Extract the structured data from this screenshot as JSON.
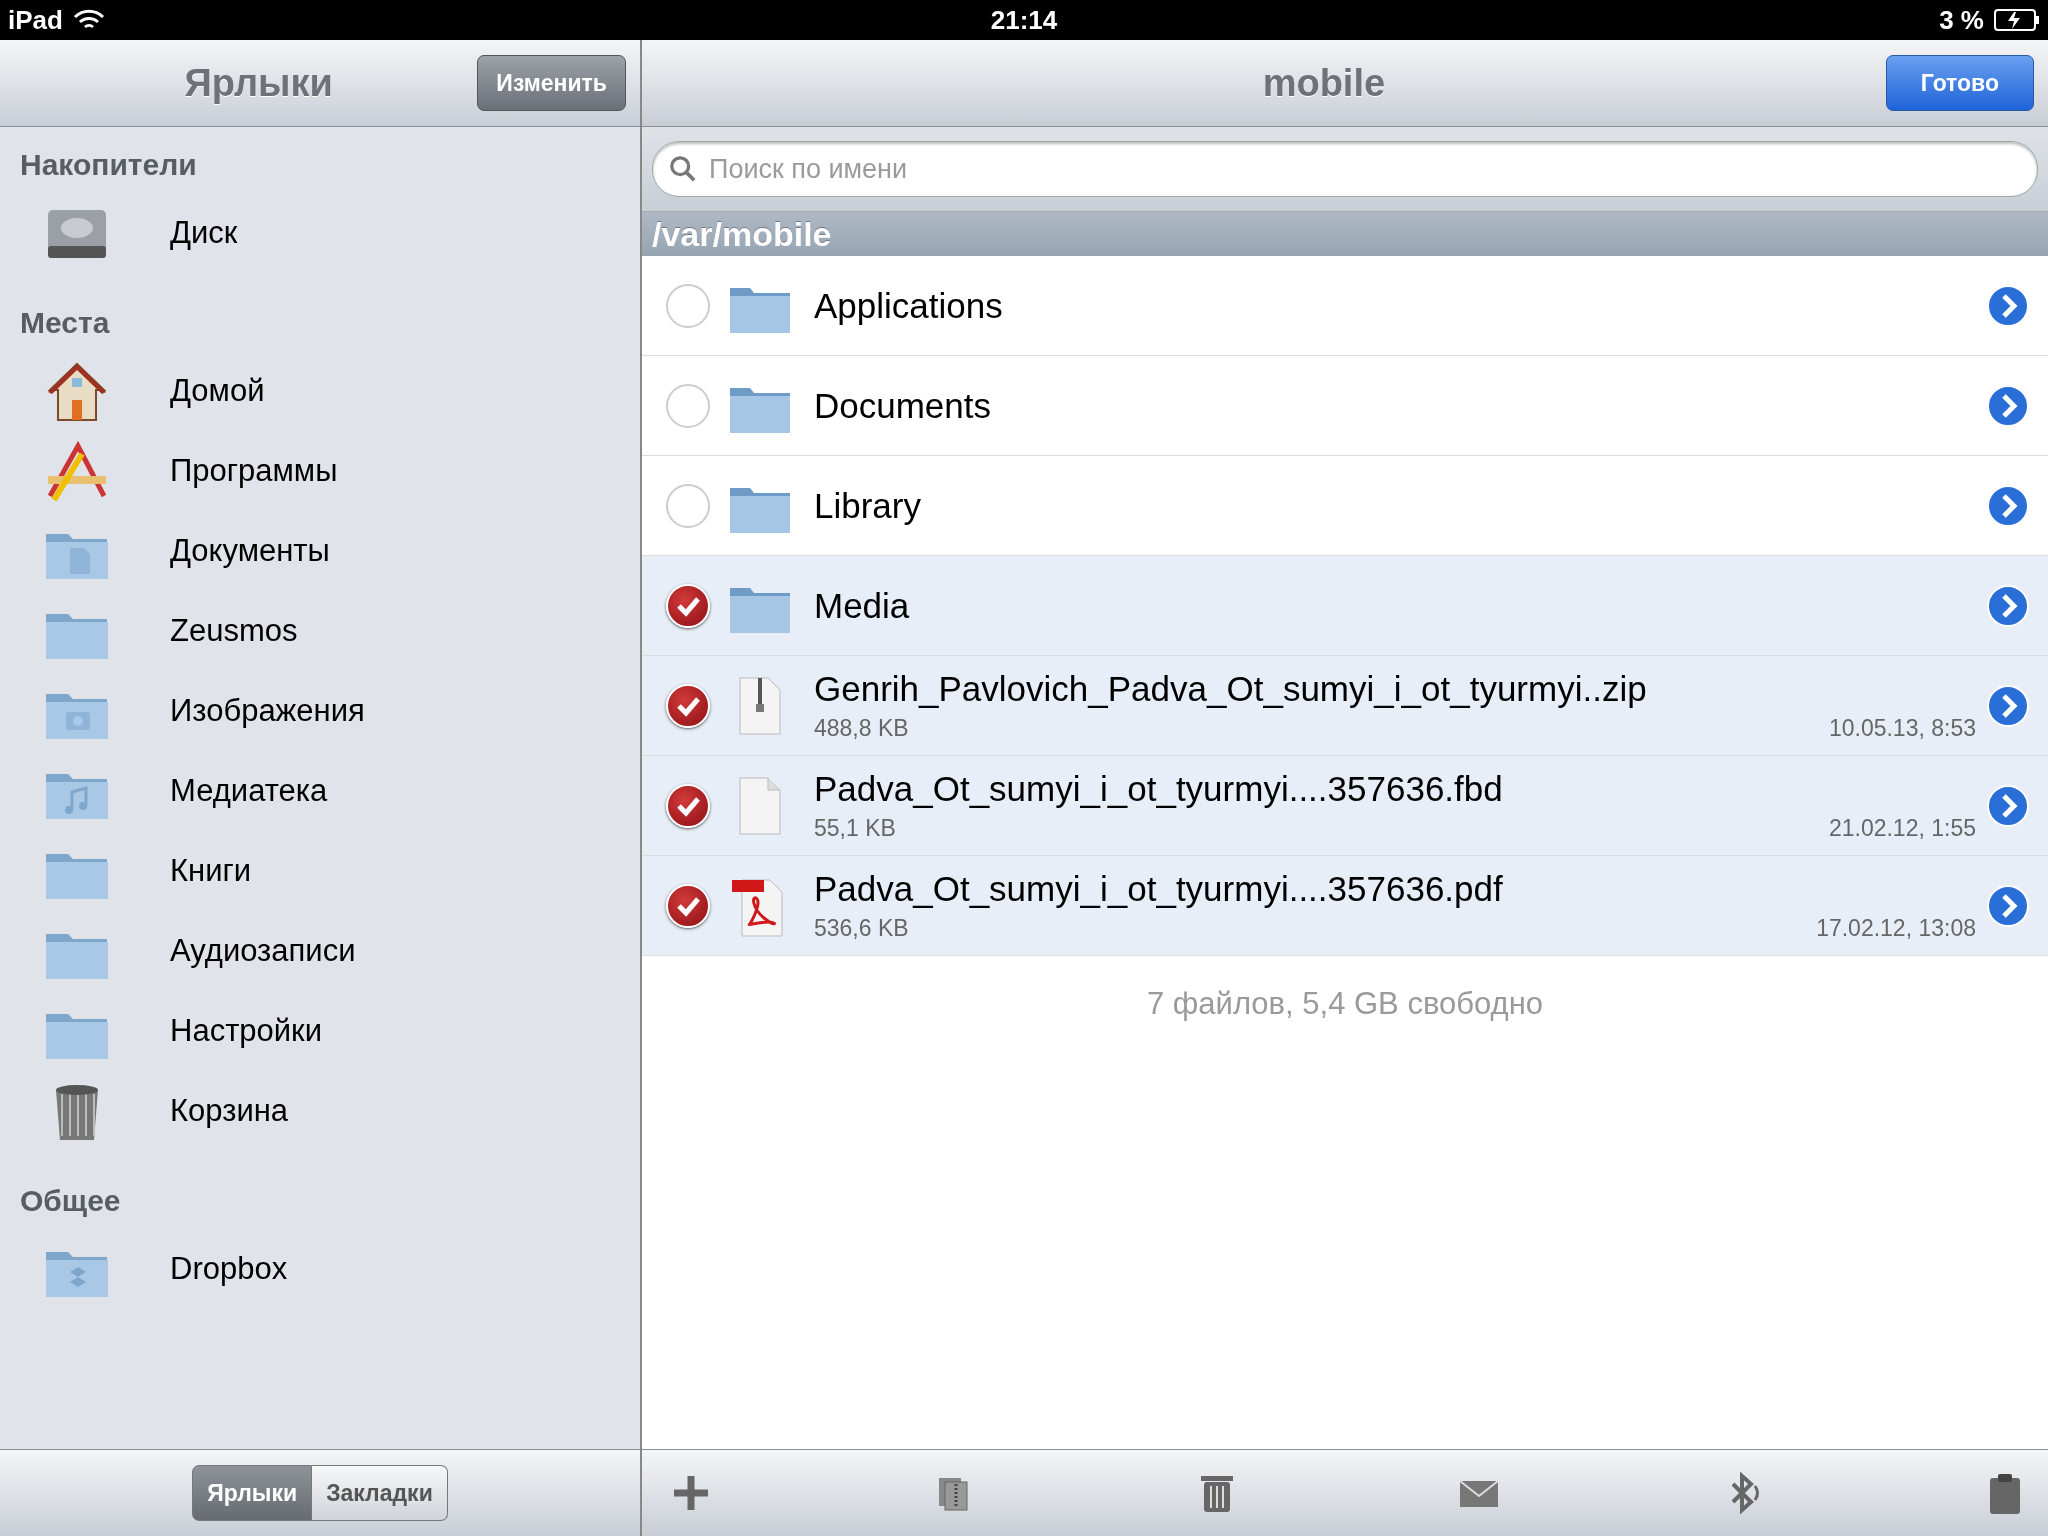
{
  "status_bar": {
    "device": "iPad",
    "time": "21:14",
    "battery": "3 %"
  },
  "sidebar": {
    "title": "Ярлыки",
    "edit_button": "Изменить",
    "sections": [
      {
        "title": "Накопители",
        "items": [
          {
            "kind": "disk",
            "label": "Диск"
          }
        ]
      },
      {
        "title": "Места",
        "items": [
          {
            "kind": "home",
            "label": "Домой"
          },
          {
            "kind": "apps",
            "label": "Программы"
          },
          {
            "kind": "folder-doc",
            "label": "Документы"
          },
          {
            "kind": "folder",
            "label": "Zeusmos"
          },
          {
            "kind": "folder-camera",
            "label": "Изображения"
          },
          {
            "kind": "folder-music",
            "label": "Медиатека"
          },
          {
            "kind": "folder",
            "label": "Книги"
          },
          {
            "kind": "folder",
            "label": "Аудиозаписи"
          },
          {
            "kind": "folder",
            "label": "Настройки"
          },
          {
            "kind": "trash",
            "label": "Корзина"
          }
        ]
      },
      {
        "title": "Общее",
        "items": [
          {
            "kind": "folder-box",
            "label": "Dropbox"
          }
        ]
      }
    ],
    "segments": [
      {
        "label": "Ярлыки",
        "selected": true
      },
      {
        "label": "Закладки",
        "selected": false
      }
    ]
  },
  "main": {
    "title": "mobile",
    "done_button": "Готово",
    "search": {
      "placeholder": "Поиск по имени"
    },
    "path": "/var/mobile",
    "files": [
      {
        "kind": "folder",
        "name": "Applications",
        "selected": false
      },
      {
        "kind": "folder",
        "name": "Documents",
        "selected": false
      },
      {
        "kind": "folder",
        "name": "Library",
        "selected": false
      },
      {
        "kind": "folder",
        "name": "Media",
        "selected": true
      },
      {
        "kind": "zip",
        "name": "Genrih_Pavlovich_Padva_Ot_sumyi_i_ot_tyurmyi..zip",
        "size": "488,8 KB",
        "date": "10.05.13, 8:53",
        "selected": true
      },
      {
        "kind": "file",
        "name": "Padva_Ot_sumyi_i_ot_tyurmyi....357636.fbd",
        "size": "55,1 KB",
        "date": "21.02.12, 1:55",
        "selected": true
      },
      {
        "kind": "pdf",
        "name": "Padva_Ot_sumyi_i_ot_tyurmyi....357636.pdf",
        "size": "536,6 KB",
        "date": "17.02.12, 13:08",
        "selected": true
      }
    ],
    "summary": "7 файлов, 5,4 GB свободно"
  }
}
